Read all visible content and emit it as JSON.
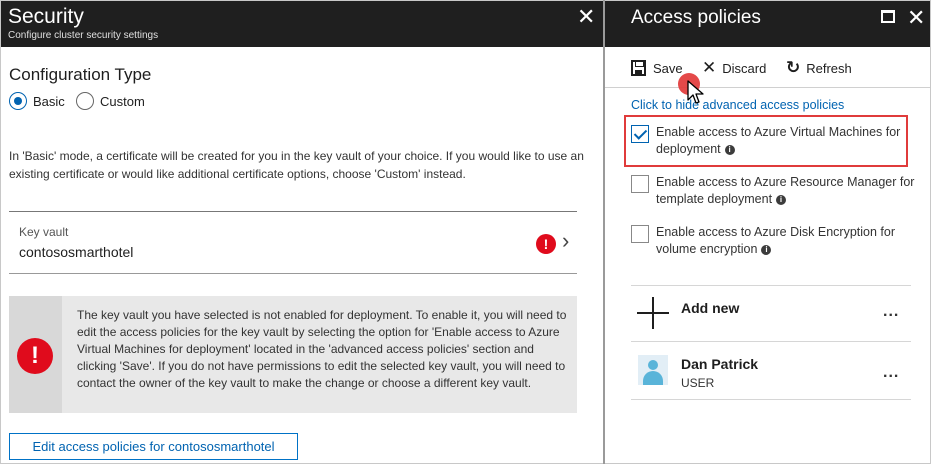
{
  "left_blade": {
    "title": "Security",
    "subtitle": "Configure cluster security settings",
    "close_glyph": "✕",
    "config_type_label": "Configuration Type",
    "radio_options": [
      {
        "label": "Basic",
        "selected": true
      },
      {
        "label": "Custom",
        "selected": false
      }
    ],
    "description": "In 'Basic' mode, a certificate will be created for you in the key vault of your choice. If you would like to use an existing certificate or would like additional certificate options, choose 'Custom' instead.",
    "key_vault": {
      "label": "Key vault",
      "value": "contososmarthotel",
      "status_glyph": "!",
      "chevron_glyph": "›"
    },
    "warning": {
      "icon_glyph": "!",
      "text": "The key vault you have selected is not enabled for deployment. To enable it, you will need to edit the access policies for the key vault by selecting the option for 'Enable access to Azure Virtual Machines for deployment' located in the 'advanced access policies' section and clicking 'Save'. If you do not have permissions to edit the selected key vault, you will need to contact the owner of the key vault to make the change or choose a different key vault."
    },
    "edit_button_label": "Edit access policies for contososmarthotel"
  },
  "right_blade": {
    "title": "Access policies",
    "close_glyph": "✕",
    "toolbar": {
      "save_label": "Save",
      "discard_label": "Discard",
      "discard_glyph": "✕",
      "refresh_label": "Refresh",
      "refresh_glyph": "↻"
    },
    "advanced_link": "Click to hide advanced access policies",
    "checkboxes": [
      {
        "label": "Enable access to Azure Virtual Machines for deployment",
        "checked": true
      },
      {
        "label": "Enable access to Azure Resource Manager for template deployment",
        "checked": false
      },
      {
        "label": "Enable access to Azure Disk Encryption for volume encryption",
        "checked": false
      }
    ],
    "info_glyph": "i",
    "add_new_label": "Add new",
    "more_glyph": "...",
    "user": {
      "name": "Dan Patrick",
      "role": "USER"
    }
  },
  "colors": {
    "header_bg": "#1f1f1f",
    "accent_blue": "#0063b1",
    "error_red": "#e00b1c",
    "highlight_red": "#e03b3b"
  }
}
